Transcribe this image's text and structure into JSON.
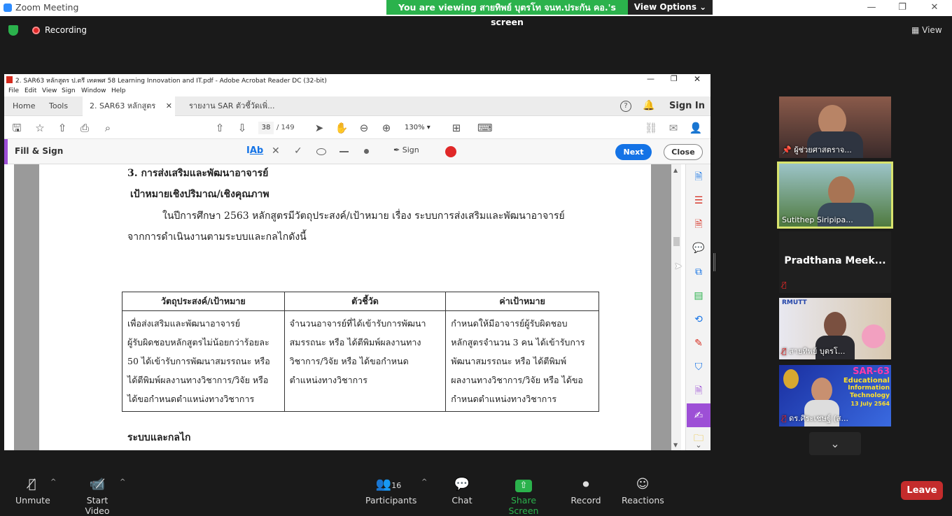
{
  "window": {
    "title": "Zoom Meeting",
    "minimize": "—",
    "maximize": "❐",
    "close": "✕"
  },
  "banner": {
    "text": "You are viewing สายทิพย์ บุตรโท จนท.ประกัน คอ.'s screen",
    "view_options": "View Options ⌄"
  },
  "meeting": {
    "recording_label": "Recording",
    "view_label": "View"
  },
  "acrobat": {
    "title": "2. SAR63 หลักสูตร ป.ตรี เทคพศ 58 Learning Innovation and IT.pdf - Adobe Acrobat Reader DC (32-bit)",
    "menu": [
      "File",
      "Edit",
      "View",
      "Sign",
      "Window",
      "Help"
    ],
    "tabs": {
      "home": "Home",
      "tools": "Tools",
      "doc1": "2. SAR63 หลักสูตร ป...",
      "doc2": "รายงาน SAR ตัวชี้วัดเพิ่..."
    },
    "sign_in": "Sign In",
    "page_current": "38",
    "page_total": "/ 149",
    "zoom": "130%",
    "fill_sign": {
      "label": "Fill & Sign",
      "sign": "Sign",
      "next": "Next",
      "close": "Close"
    }
  },
  "document": {
    "heading": "3.  การส่งเสริมและพัฒนาอาจารย์",
    "subheading": "เป้าหมายเชิงปริมาณ/เชิงคุณภาพ",
    "para_line1": "ในปีการศึกษา 2563 หลักสูตรมีวัตถุประสงค์/เป้าหมาย เรื่อง ระบบการส่งเสริมและพัฒนาอาจารย์",
    "para_line2": "จากการดำเนินงานตามระบบและกลไกดังนี้",
    "table": {
      "headers": [
        "วัตถุประสงค์/เป้าหมาย",
        "ตัวชี้วัด",
        "ค่าเป้าหมาย"
      ],
      "col1": [
        "เพื่อส่งเสริมและพัฒนาอาจารย์",
        "ผู้รับผิดชอบหลักสูตรไม่น้อยกว่าร้อยละ",
        "50 ได้เข้ารับการพัฒนาสมรรถนะ หรือ",
        "ได้ตีพิมพ์ผลงานทางวิชาการ/วิจัย หรือ",
        "ได้ขอกำหนดตำแหน่งทางวิชาการ"
      ],
      "col2": [
        "จำนวนอาจารย์ที่ได้เข้ารับการพัฒนา",
        "สมรรถนะ หรือ ได้ตีพิมพ์ผลงานทาง",
        "วิชาการ/วิจัย หรือ ได้ขอกำหนด",
        "ตำแหน่งทางวิชาการ"
      ],
      "col3": [
        "กำหนดให้มีอาจารย์ผู้รับผิดชอบ",
        "หลักสูตรจำนวน 3 คน ได้เข้ารับการ",
        "พัฒนาสมรรถนะ หรือ ได้ตีพิมพ์",
        "ผลงานทางวิชาการ/วิจัย หรือ ได้ขอ",
        "กำหนดตำแหน่งทางวิชาการ"
      ]
    },
    "footer_heading": "ระบบและกลไก"
  },
  "participants_panel": {
    "tiles": [
      {
        "name": "ผู้ช่วยศาสตราจ..."
      },
      {
        "name": "Sutithep Siripipa..."
      },
      {
        "name": "Pradthana  Meek..."
      },
      {
        "name": "สายทิพย์ บุตรโ..."
      },
      {
        "name": "ดร.ศิระเชษฐ์ (ส..."
      }
    ],
    "banner_tile": {
      "line1": "SAR-63",
      "line2": "Educational",
      "line3": "Information",
      "line4": "Technology",
      "line5": "13 July 2564"
    },
    "rmutt_label": "RMUTT"
  },
  "toolbar": {
    "unmute": "Unmute",
    "start_video": "Start Video",
    "participants": "Participants",
    "participants_count": "16",
    "chat": "Chat",
    "share_screen": "Share Screen",
    "record": "Record",
    "reactions": "Reactions",
    "leave": "Leave"
  },
  "colors": {
    "share_green": "#2bb24c",
    "acrobat_blue": "#1473e6",
    "leave_red": "#c42c2c",
    "fill_sign_purple": "#9d4fd6"
  }
}
